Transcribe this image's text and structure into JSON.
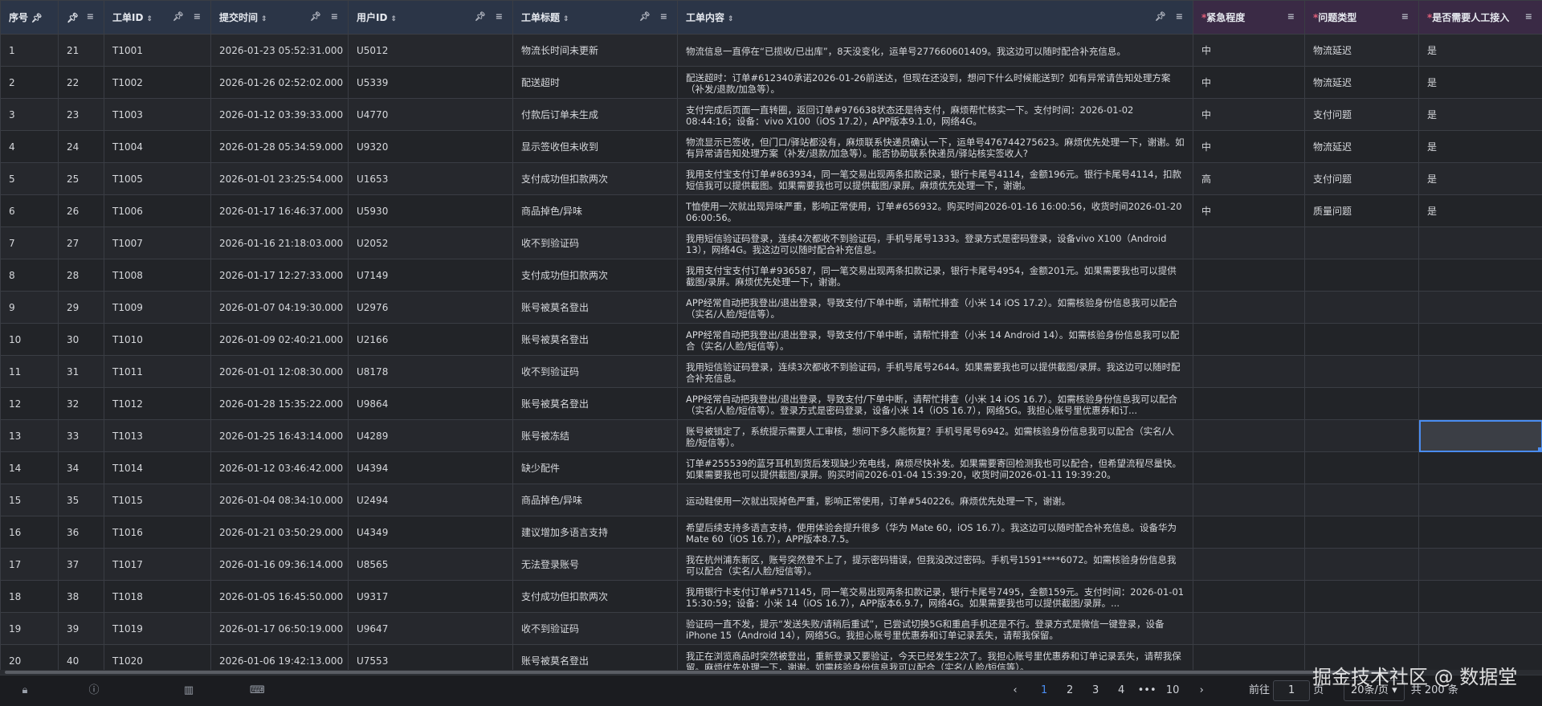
{
  "columns": [
    {
      "label": "序号",
      "sort": false
    },
    {
      "label": "",
      "sort": false
    },
    {
      "label": "工单ID",
      "sort": true
    },
    {
      "label": "提交时间",
      "sort": true
    },
    {
      "label": "用户ID",
      "sort": true
    },
    {
      "label": "工单标题",
      "sort": true
    },
    {
      "label": "工单内容",
      "sort": true
    },
    {
      "label": "紧急程度",
      "ai": true
    },
    {
      "label": "问题类型",
      "ai": true
    },
    {
      "label": "是否需要人工接入",
      "ai": true
    }
  ],
  "rows": [
    {
      "seq": "1",
      "idx": "21",
      "id": "T1001",
      "time": "2026-01-23 05:52:31.000",
      "user": "U5012",
      "title": "物流长时间未更新",
      "content": "物流信息一直停在“已揽收/已出库”，8天没变化，运单号277660601409。我这边可以随时配合补充信息。",
      "urgency": "中",
      "type": "物流延迟",
      "human": "是"
    },
    {
      "seq": "2",
      "idx": "22",
      "id": "T1002",
      "time": "2026-01-26 02:52:02.000",
      "user": "U5339",
      "title": "配送超时",
      "content": "配送超时：订单#612340承诺2026-01-26前送达，但现在还没到，想问下什么时候能送到？如有异常请告知处理方案（补发/退款/加急等）。",
      "urgency": "中",
      "type": "物流延迟",
      "human": "是"
    },
    {
      "seq": "3",
      "idx": "23",
      "id": "T1003",
      "time": "2026-01-12 03:39:33.000",
      "user": "U4770",
      "title": "付款后订单未生成",
      "content": "支付完成后页面一直转圈，返回订单#976638状态还是待支付，麻烦帮忙核实一下。支付时间：2026-01-02 08:44:16；设备：vivo X100（iOS 17.2），APP版本9.1.0，网络4G。",
      "urgency": "中",
      "type": "支付问题",
      "human": "是"
    },
    {
      "seq": "4",
      "idx": "24",
      "id": "T1004",
      "time": "2026-01-28 05:34:59.000",
      "user": "U9320",
      "title": "显示签收但未收到",
      "content": "物流显示已签收，但门口/驿站都没有，麻烦联系快递员确认一下，运单号476744275623。麻烦优先处理一下，谢谢。如有异常请告知处理方案（补发/退款/加急等）。能否协助联系快递员/驿站核实签收人?",
      "urgency": "中",
      "type": "物流延迟",
      "human": "是"
    },
    {
      "seq": "5",
      "idx": "25",
      "id": "T1005",
      "time": "2026-01-01 23:25:54.000",
      "user": "U1653",
      "title": "支付成功但扣款两次",
      "content": "我用支付宝支付订单#863934，同一笔交易出现两条扣款记录，银行卡尾号4114，金额196元。银行卡尾号4114，扣款短信我可以提供截图。如果需要我也可以提供截图/录屏。麻烦优先处理一下，谢谢。",
      "urgency": "高",
      "type": "支付问题",
      "human": "是"
    },
    {
      "seq": "6",
      "idx": "26",
      "id": "T1006",
      "time": "2026-01-17 16:46:37.000",
      "user": "U5930",
      "title": "商品掉色/异味",
      "content": "T恤使用一次就出现异味严重，影响正常使用，订单#656932。购买时间2026-01-16 16:00:56，收货时间2026-01-20 06:00:56。",
      "urgency": "中",
      "type": "质量问题",
      "human": "是"
    },
    {
      "seq": "7",
      "idx": "27",
      "id": "T1007",
      "time": "2026-01-16 21:18:03.000",
      "user": "U2052",
      "title": "收不到验证码",
      "content": "我用短信验证码登录，连续4次都收不到验证码，手机号尾号1333。登录方式是密码登录，设备vivo X100（Android 13），网络4G。我这边可以随时配合补充信息。",
      "urgency": "",
      "type": "",
      "human": ""
    },
    {
      "seq": "8",
      "idx": "28",
      "id": "T1008",
      "time": "2026-01-17 12:27:33.000",
      "user": "U7149",
      "title": "支付成功但扣款两次",
      "content": "我用支付宝支付订单#936587，同一笔交易出现两条扣款记录，银行卡尾号4954，金额201元。如果需要我也可以提供截图/录屏。麻烦优先处理一下，谢谢。",
      "urgency": "",
      "type": "",
      "human": ""
    },
    {
      "seq": "9",
      "idx": "29",
      "id": "T1009",
      "time": "2026-01-07 04:19:30.000",
      "user": "U2976",
      "title": "账号被莫名登出",
      "content": "APP经常自动把我登出/退出登录，导致支付/下单中断，请帮忙排查（小米 14 iOS 17.2）。如需核验身份信息我可以配合（实名/人脸/短信等）。",
      "urgency": "",
      "type": "",
      "human": ""
    },
    {
      "seq": "10",
      "idx": "30",
      "id": "T1010",
      "time": "2026-01-09 02:40:21.000",
      "user": "U2166",
      "title": "账号被莫名登出",
      "content": "APP经常自动把我登出/退出登录，导致支付/下单中断，请帮忙排查（小米 14 Android 14）。如需核验身份信息我可以配合（实名/人脸/短信等）。",
      "urgency": "",
      "type": "",
      "human": ""
    },
    {
      "seq": "11",
      "idx": "31",
      "id": "T1011",
      "time": "2026-01-01 12:08:30.000",
      "user": "U8178",
      "title": "收不到验证码",
      "content": "我用短信验证码登录，连续3次都收不到验证码，手机号尾号2644。如果需要我也可以提供截图/录屏。我这边可以随时配合补充信息。",
      "urgency": "",
      "type": "",
      "human": ""
    },
    {
      "seq": "12",
      "idx": "32",
      "id": "T1012",
      "time": "2026-01-28 15:35:22.000",
      "user": "U9864",
      "title": "账号被莫名登出",
      "content": "APP经常自动把我登出/退出登录，导致支付/下单中断，请帮忙排查（小米 14 iOS 16.7）。如需核验身份信息我可以配合（实名/人脸/短信等）。登录方式是密码登录，设备小米 14（iOS 16.7），网络5G。我担心账号里优惠券和订...",
      "urgency": "",
      "type": "",
      "human": ""
    },
    {
      "seq": "13",
      "idx": "33",
      "id": "T1013",
      "time": "2026-01-25 16:43:14.000",
      "user": "U4289",
      "title": "账号被冻结",
      "content": "账号被锁定了，系统提示需要人工审核，想问下多久能恢复？手机号尾号6942。如需核验身份信息我可以配合（实名/人脸/短信等）。",
      "urgency": "",
      "type": "",
      "human": ""
    },
    {
      "seq": "14",
      "idx": "34",
      "id": "T1014",
      "time": "2026-01-12 03:46:42.000",
      "user": "U4394",
      "title": "缺少配件",
      "content": "订单#255539的蓝牙耳机到货后发现缺少充电线，麻烦尽快补发。如果需要寄回检测我也可以配合，但希望流程尽量快。如果需要我也可以提供截图/录屏。购买时间2026-01-04 15:39:20，收货时间2026-01-11 19:39:20。",
      "urgency": "",
      "type": "",
      "human": ""
    },
    {
      "seq": "15",
      "idx": "35",
      "id": "T1015",
      "time": "2026-01-04 08:34:10.000",
      "user": "U2494",
      "title": "商品掉色/异味",
      "content": "运动鞋使用一次就出现掉色严重，影响正常使用，订单#540226。麻烦优先处理一下，谢谢。",
      "urgency": "",
      "type": "",
      "human": ""
    },
    {
      "seq": "16",
      "idx": "36",
      "id": "T1016",
      "time": "2026-01-21 03:50:29.000",
      "user": "U4349",
      "title": "建议增加多语言支持",
      "content": "希望后续支持多语言支持，使用体验会提升很多（华为 Mate 60，iOS 16.7）。我这边可以随时配合补充信息。设备华为 Mate 60（iOS 16.7），APP版本8.7.5。",
      "urgency": "",
      "type": "",
      "human": ""
    },
    {
      "seq": "17",
      "idx": "37",
      "id": "T1017",
      "time": "2026-01-16 09:36:14.000",
      "user": "U8565",
      "title": "无法登录账号",
      "content": "我在杭州浦东新区，账号突然登不上了，提示密码错误，但我没改过密码。手机号1591****6072。如需核验身份信息我可以配合（实名/人脸/短信等）。",
      "urgency": "",
      "type": "",
      "human": ""
    },
    {
      "seq": "18",
      "idx": "38",
      "id": "T1018",
      "time": "2026-01-05 16:45:50.000",
      "user": "U9317",
      "title": "支付成功但扣款两次",
      "content": "我用银行卡支付订单#571145，同一笔交易出现两条扣款记录，银行卡尾号7495，金额159元。支付时间：2026-01-01 15:30:59；设备：小米 14（iOS 16.7），APP版本6.9.7，网络4G。如果需要我也可以提供截图/录屏。...",
      "urgency": "",
      "type": "",
      "human": ""
    },
    {
      "seq": "19",
      "idx": "39",
      "id": "T1019",
      "time": "2026-01-17 06:50:19.000",
      "user": "U9647",
      "title": "收不到验证码",
      "content": "验证码一直不发，提示“发送失败/请稍后重试”，已尝试切换5G和重启手机还是不行。登录方式是微信一键登录，设备iPhone 15（Android 14），网络5G。我担心账号里优惠券和订单记录丢失，请帮我保留。",
      "urgency": "",
      "type": "",
      "human": ""
    },
    {
      "seq": "20",
      "idx": "40",
      "id": "T1020",
      "time": "2026-01-06 19:42:13.000",
      "user": "U7553",
      "title": "账号被莫名登出",
      "content": "我正在浏览商品时突然被登出，重新登录又要验证，今天已经发生2次了。我担心账号里优惠券和订单记录丢失，请帮我保留。麻烦优先处理一下，谢谢。如需核验身份信息我可以配合（实名/人脸/短信等）。",
      "urgency": "",
      "type": "",
      "human": ""
    }
  ],
  "pager": {
    "pages": [
      "1",
      "2",
      "3",
      "4",
      "•••",
      "10"
    ],
    "active": "1",
    "goto_label": "前往",
    "goto_value": "1",
    "page_unit": "页",
    "page_size": "20条/页",
    "total": "共 200 条"
  },
  "watermark": "掘金技术社区 @ 数据堂",
  "colors": {
    "header": "#2b3547",
    "ai_header": "#3a2a45",
    "accent": "#4a8cf0",
    "required_star": "#e0607a"
  }
}
